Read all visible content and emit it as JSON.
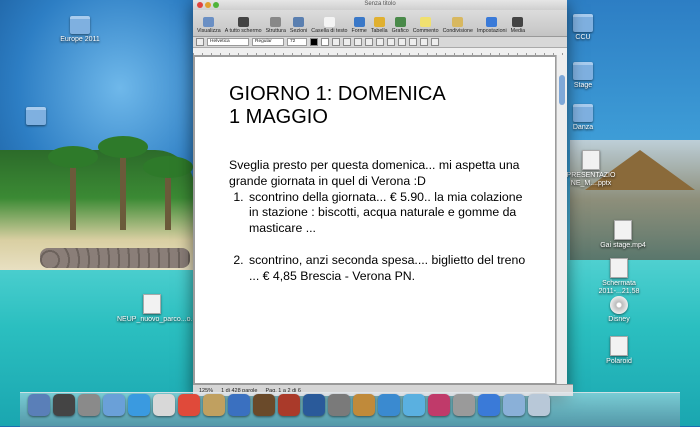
{
  "window": {
    "title": "Senza titolo",
    "toolbar": [
      {
        "label": "Visualizza",
        "icon": "view-icon",
        "color": "#6a8fc4"
      },
      {
        "label": "A tutto schermo",
        "icon": "fullscreen-icon",
        "color": "#444444"
      },
      {
        "label": "Struttura",
        "icon": "layout-icon",
        "color": "#888888"
      },
      {
        "label": "Sezioni",
        "icon": "sections-icon",
        "color": "#5a7fb0"
      },
      {
        "label": "Casella di testo",
        "icon": "textbox-icon",
        "color": "#f4f4f4"
      },
      {
        "label": "Forme",
        "icon": "shapes-icon",
        "color": "#3a78c8"
      },
      {
        "label": "Tabella",
        "icon": "table-icon",
        "color": "#e0b030"
      },
      {
        "label": "Grafico",
        "icon": "chart-icon",
        "color": "#4a8a4a"
      },
      {
        "label": "Commento",
        "icon": "comment-icon",
        "color": "#f0e070"
      },
      {
        "label": "Condivisione",
        "icon": "share-icon",
        "color": "#d8b860"
      },
      {
        "label": "Impostazioni",
        "icon": "info-icon",
        "color": "#3a7ad8"
      },
      {
        "label": "Media",
        "icon": "media-icon",
        "color": "#444444"
      }
    ],
    "format": {
      "font": "Helvetica",
      "style": "Regular",
      "size": "72"
    },
    "status": {
      "zoom": "125%",
      "words": "1 di 428 parole",
      "pages": "Pag. 1 a 2 di 6"
    }
  },
  "document": {
    "title_line1": "GIORNO 1: DOMENICA",
    "title_line2": "1 MAGGIO",
    "intro": "Sveglia presto per questa domenica... mi aspetta una grande giornata in quel di Verona :D",
    "items": [
      "scontrino della giornata... € 5.90.. la mia colazione in stazione : biscotti, acqua naturale e gomme da masticare ...",
      "scontrino, anzi seconda spesa.... biglietto del treno ... € 4,85 Brescia - Verona PN."
    ]
  },
  "desktop": {
    "icons_left": [
      {
        "label": "Europe 2011"
      },
      {
        "label": "NEUP_nuovo_parco...o...pdf"
      }
    ],
    "icons_right": [
      {
        "label": "CCU"
      },
      {
        "label": "Stage"
      },
      {
        "label": "Danza"
      },
      {
        "label": "PRESENTAZIO NE_M....pptx"
      },
      {
        "label": "Gai stage.mp4"
      },
      {
        "label": "Schermata 2011-...21.58"
      },
      {
        "label": "Disney"
      },
      {
        "label": "Polaroid"
      }
    ]
  },
  "colors": {
    "accent": "#3a78c8",
    "text": "#000000"
  }
}
